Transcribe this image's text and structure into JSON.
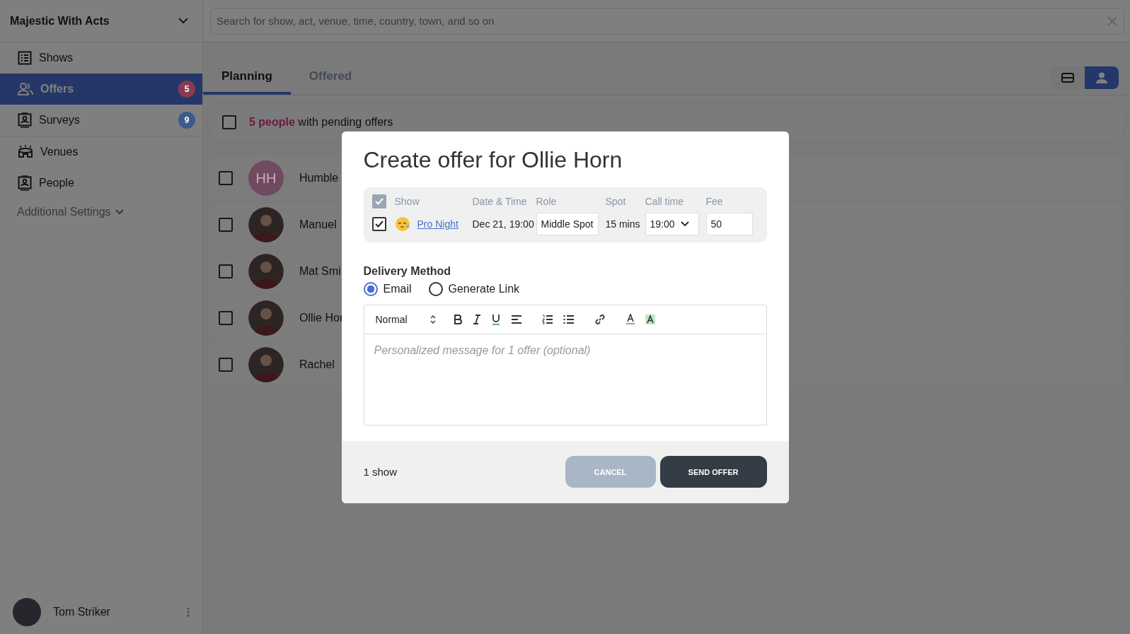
{
  "workspace": {
    "name": "Majestic With Acts"
  },
  "search": {
    "placeholder": "Search for show, act, venue, time, country, town, and so on"
  },
  "nav": [
    {
      "label": "Shows",
      "selected": false
    },
    {
      "label": "Offers",
      "selected": true,
      "badge": "5",
      "color": "#8a3a52"
    },
    {
      "label": "Surveys",
      "selected": false,
      "badge": "9",
      "color": "#3d5a8a"
    },
    {
      "label": "Venues",
      "selected": false
    },
    {
      "label": "People",
      "selected": false
    }
  ],
  "additional_settings": {
    "label": "Additional Settings"
  },
  "user": {
    "name": "Tom Striker"
  },
  "tabs": [
    {
      "label": "Planning",
      "selected": true
    },
    {
      "label": "Offered",
      "selected": false
    }
  ],
  "view_toggle": [
    {
      "kind": "rows",
      "selected": false
    },
    {
      "kind": "person",
      "selected": true
    }
  ],
  "summary": {
    "checked": false,
    "count": "5 people",
    "text": "with pending offers"
  },
  "people": [
    {
      "name": "Humble",
      "initials": "HH",
      "checked": false
    },
    {
      "name": "Manuel",
      "checked": false
    },
    {
      "name": "Mat Smi",
      "checked": false
    },
    {
      "name": "Ollie Hor",
      "checked": false
    },
    {
      "name": "Rachel",
      "checked": false
    }
  ],
  "modal": {
    "title": "Create offer for Ollie Horn",
    "header_checked": true,
    "columns": [
      "Show",
      "Date & Time",
      "Role",
      "Spot",
      "Call time",
      "Fee"
    ],
    "rows": [
      {
        "checked": true,
        "show": "Pro Night",
        "date_time": "Dec 21, 19:00",
        "role": "Middle Spot",
        "spot": "15 mins",
        "call_time": "19:00",
        "fee": "50"
      }
    ],
    "delivery": {
      "label": "Delivery Method",
      "options": [
        {
          "label": "Email",
          "selected": true
        },
        {
          "label": "Generate Link",
          "selected": false
        }
      ]
    },
    "editor": {
      "format": "Normal",
      "placeholder": "Personalized message for 1 offer (optional)"
    },
    "footer": {
      "count": "1 show",
      "buttons": [
        {
          "label": "CANCEL",
          "kind": "secondary"
        },
        {
          "label": "SEND OFFER",
          "kind": "primary"
        }
      ]
    }
  }
}
